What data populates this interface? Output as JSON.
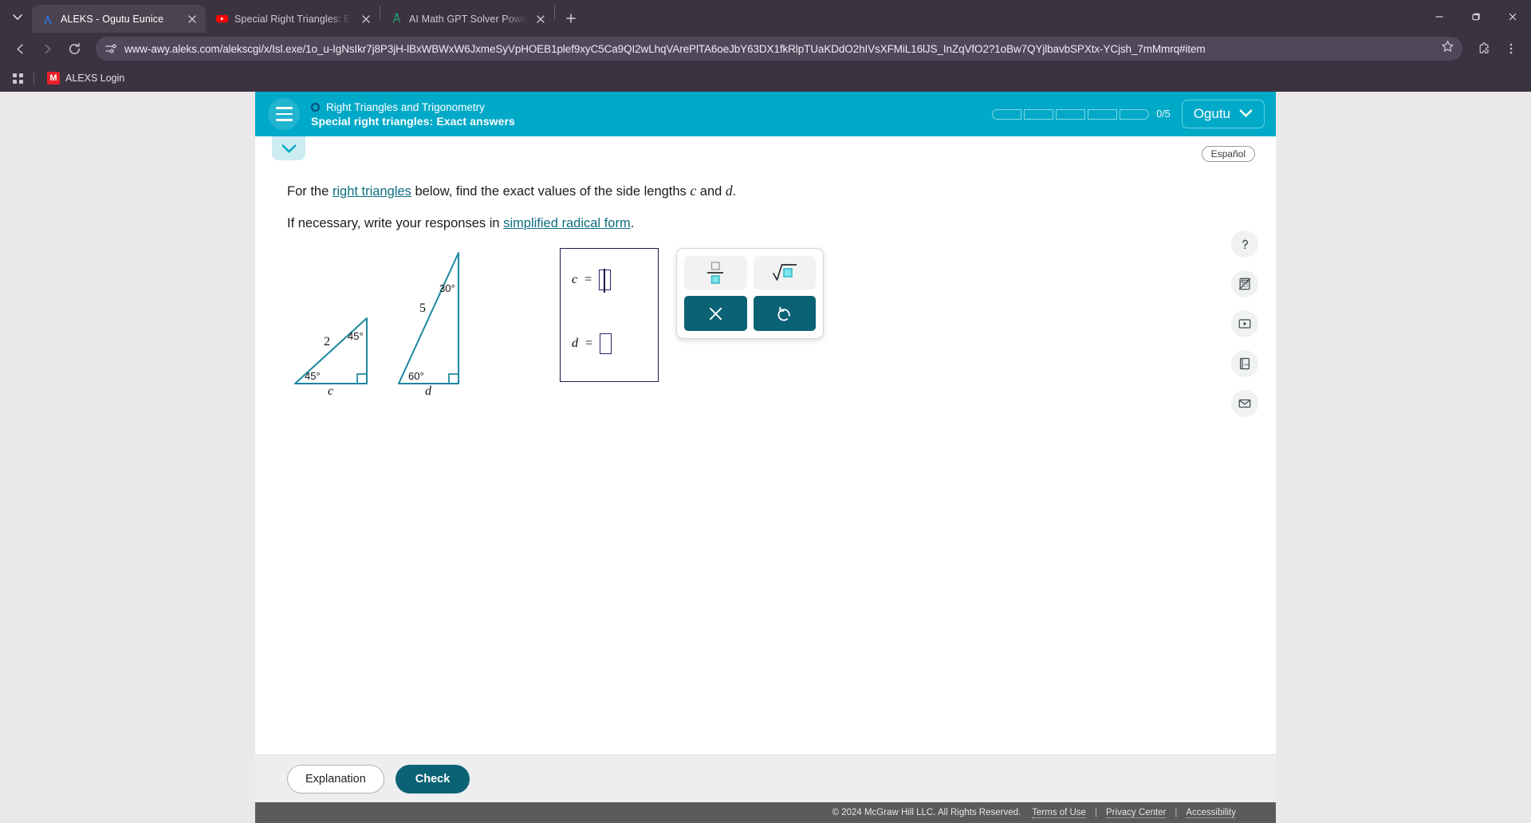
{
  "browser": {
    "tabs": [
      {
        "title": "ALEKS - Ogutu Eunice",
        "favicon": "aleks-a-icon",
        "active": true
      },
      {
        "title": "Special Right Triangles: Exact A",
        "favicon": "youtube-icon",
        "active": false
      },
      {
        "title": "AI Math GPT Solver Powered b",
        "favicon": "compass-icon",
        "active": false
      }
    ],
    "new_tab_label": "+",
    "url": "www-awy.aleks.com/alekscgi/x/Isl.exe/1o_u-IgNsIkr7j8P3jH-lBxWBWxW6JxmeSyVpHOEB1plef9xyC5Ca9QI2wLhqVArePlTA6oeJbY63DX1fkRlpTUaKDdO2hIVsXFMiL16lJS_InZqVfO2?1oBw7QYjlbavbSPXtx-YCjsh_7mMmrq#item",
    "bookmarks": [
      {
        "label": "ALEXS Login",
        "icon_letter": "M"
      }
    ],
    "window_controls": [
      "minimize",
      "maximize",
      "close"
    ]
  },
  "aleks": {
    "header": {
      "topic": "Right Triangles and Trigonometry",
      "subtitle": "Special right triangles: Exact answers",
      "progress": {
        "segments": 5,
        "filled": 0,
        "count_label": "0/5"
      },
      "user_name": "Ogutu",
      "accent_color": "#00a9c8"
    },
    "espanol_label": "Español",
    "question": {
      "line1_pre": "For the ",
      "line1_link": "right triangles",
      "line1_mid": " below, find the exact values of the side lengths ",
      "line1_var1": "c",
      "line1_and": " and ",
      "line1_var2": "d",
      "line1_end": ".",
      "line2_pre": "If necessary, write your responses in ",
      "line2_link": "simplified radical form",
      "line2_end": "."
    },
    "figure": {
      "triangle1": {
        "hypotenuse_label": "2",
        "angle_bottom_left": "45°",
        "angle_top_right": "45°",
        "base_label": "c",
        "stroke_color": "#1b87a0"
      },
      "triangle2": {
        "hypotenuse_label": "5",
        "angle_bottom_left": "60°",
        "angle_top_right": "30°",
        "base_label": "d",
        "stroke_color": "#1b87a0"
      }
    },
    "answers": [
      {
        "label": "c",
        "equals": "=",
        "value": "",
        "focused": true
      },
      {
        "label": "d",
        "equals": "=",
        "value": "",
        "focused": false
      }
    ],
    "keypad": {
      "keys": [
        {
          "name": "fraction-key",
          "glyph": "fraction"
        },
        {
          "name": "square-root-key",
          "glyph": "radical"
        }
      ],
      "actions": [
        {
          "name": "clear-button",
          "glyph": "×"
        },
        {
          "name": "undo-button",
          "glyph": "↺"
        }
      ],
      "accent_color": "#0b6274"
    },
    "rail_icons": [
      {
        "name": "help-icon",
        "glyph": "?"
      },
      {
        "name": "calculator-disabled-icon",
        "glyph": "calculator"
      },
      {
        "name": "video-icon",
        "glyph": "play"
      },
      {
        "name": "glossary-icon",
        "glyph": "Aa"
      },
      {
        "name": "message-icon",
        "glyph": "envelope"
      }
    ],
    "footer": {
      "explanation_label": "Explanation",
      "check_label": "Check"
    },
    "copyright": {
      "text": "© 2024 McGraw Hill LLC. All Rights Reserved.",
      "links": [
        "Terms of Use",
        "Privacy Center",
        "Accessibility"
      ],
      "separator": "|"
    }
  }
}
